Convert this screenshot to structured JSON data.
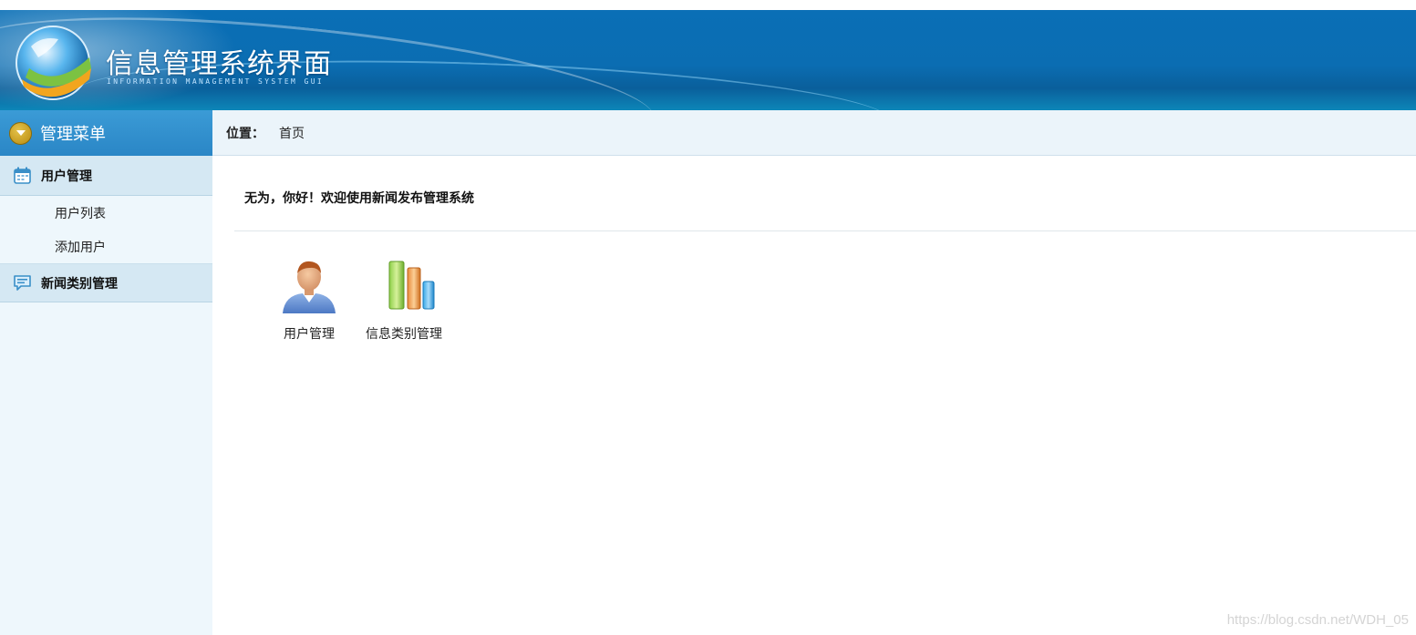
{
  "header": {
    "title": "信息管理系统界面",
    "subtitle": "INFORMATION MANAGEMENT SYSTEM GUI"
  },
  "sidebar": {
    "heading": "管理菜单",
    "groups": [
      {
        "label": "用户管理",
        "icon": "calendar-icon",
        "items": [
          "用户列表",
          "添加用户"
        ]
      },
      {
        "label": "新闻类别管理",
        "icon": "message-icon",
        "items": []
      }
    ]
  },
  "breadcrumb": {
    "label": "位置：",
    "current": "首页"
  },
  "main": {
    "welcome": "无为，你好！欢迎使用新闻发布管理系统",
    "tiles": [
      {
        "label": "用户管理",
        "icon": "user-icon"
      },
      {
        "label": "信息类别管理",
        "icon": "bar-chart-icon"
      }
    ]
  },
  "watermark": "https://blog.csdn.net/WDH_05",
  "colors": {
    "header_blue": "#0a6fb6",
    "sidebar_bg": "#eef7fc",
    "group_bg": "#d5e8f3",
    "accent": "#2a86c6"
  }
}
